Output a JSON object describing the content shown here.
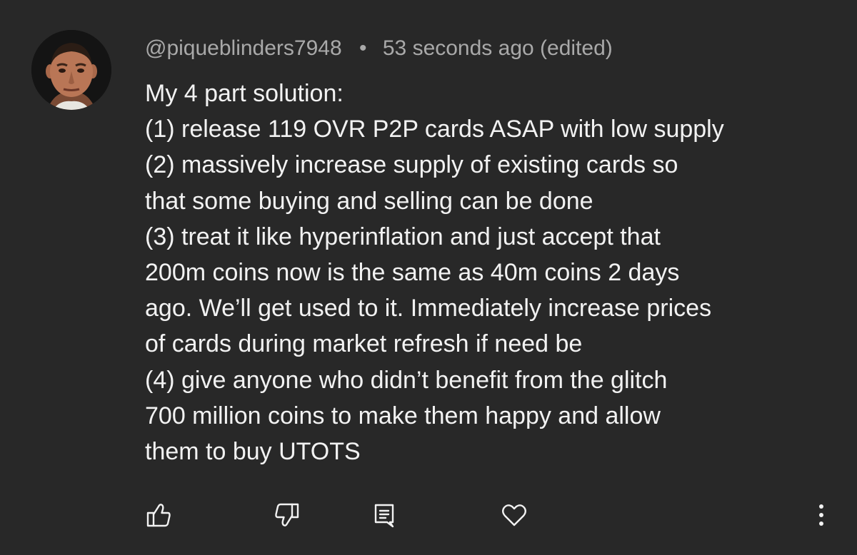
{
  "comment": {
    "author": "@piqueblinders7948",
    "separator": "•",
    "timestamp": "53 seconds ago (edited)",
    "body_lines": [
      "My 4 part solution:",
      "(1) release 119 OVR P2P cards ASAP with low supply",
      "(2) massively increase supply of existing cards so",
      "that some buying and selling can be done",
      "(3) treat it like hyperinflation and just accept that",
      "200m coins now is the same as 40m coins 2 days",
      "ago. We’ll get used to it. Immediately increase prices",
      "of cards during market refresh if need be",
      "(4) give anyone who didn’t benefit from the glitch",
      "700 million coins to make them happy and allow",
      "them to buy UTOTS"
    ]
  },
  "actions": {
    "icons": [
      "thumbs-up-icon",
      "thumbs-down-icon",
      "reply-icon",
      "heart-icon",
      "more-vertical-icon"
    ]
  },
  "colors": {
    "background": "#282828",
    "text_primary": "#f2f2f2",
    "text_secondary": "#a9a9a9",
    "icon": "#f2f2f2"
  }
}
